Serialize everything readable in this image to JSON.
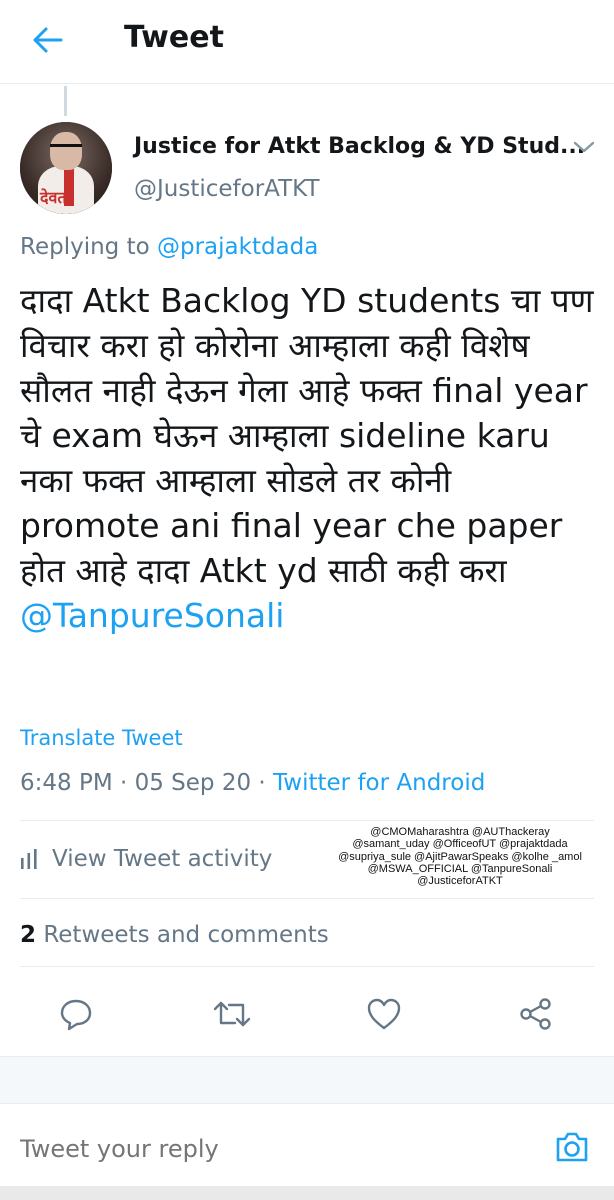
{
  "header": {
    "title": "Tweet",
    "back_icon": "arrow-left-icon"
  },
  "author": {
    "name": "Justice for Atkt Backlog & YD Stud...",
    "handle": "@JusticeforATKT",
    "avatar_caption": "देवत"
  },
  "tweet": {
    "replying_prefix": "Replying to",
    "replying_to": "@prajaktdada",
    "body": "दादा  Atkt Backlog YD students चा पण विचार  करा  हो कोरोना आम्हाला  कही विशेष सौलत नाही  देऊन  गेला आहे फक्त final year चे  exam घेऊन आम्हाला sideline karu नका  फक्त  आम्हाला सोडले तर कोनी promote ani final year che paper होत  आहे दादा Atkt yd साठी कही करा ",
    "mention": "@TanpureSonali",
    "translate_label": "Translate Tweet",
    "time": "6:48 PM · 05 Sep 20 · ",
    "source": "Twitter for Android"
  },
  "activity": {
    "label": "View Tweet activity"
  },
  "overlay_mentions": "@CMOMaharashtra @AUThackeray @samant_uday @OfficeofUT @prajaktdada @supriya_sule @AjitPawarSpeaks @kolhe _amol @MSWA_OFFICIAL @TanpureSonali @JusticeforATKT",
  "stats": {
    "retweets_count": "2",
    "retweets_label": " Retweets and comments"
  },
  "actions": [
    "reply-icon",
    "retweet-icon",
    "like-icon",
    "share-icon"
  ],
  "reply": {
    "placeholder": "Tweet your reply"
  },
  "colors": {
    "accent": "#1da1f2",
    "secondary_text": "#657786",
    "primary_text": "#14171a"
  }
}
